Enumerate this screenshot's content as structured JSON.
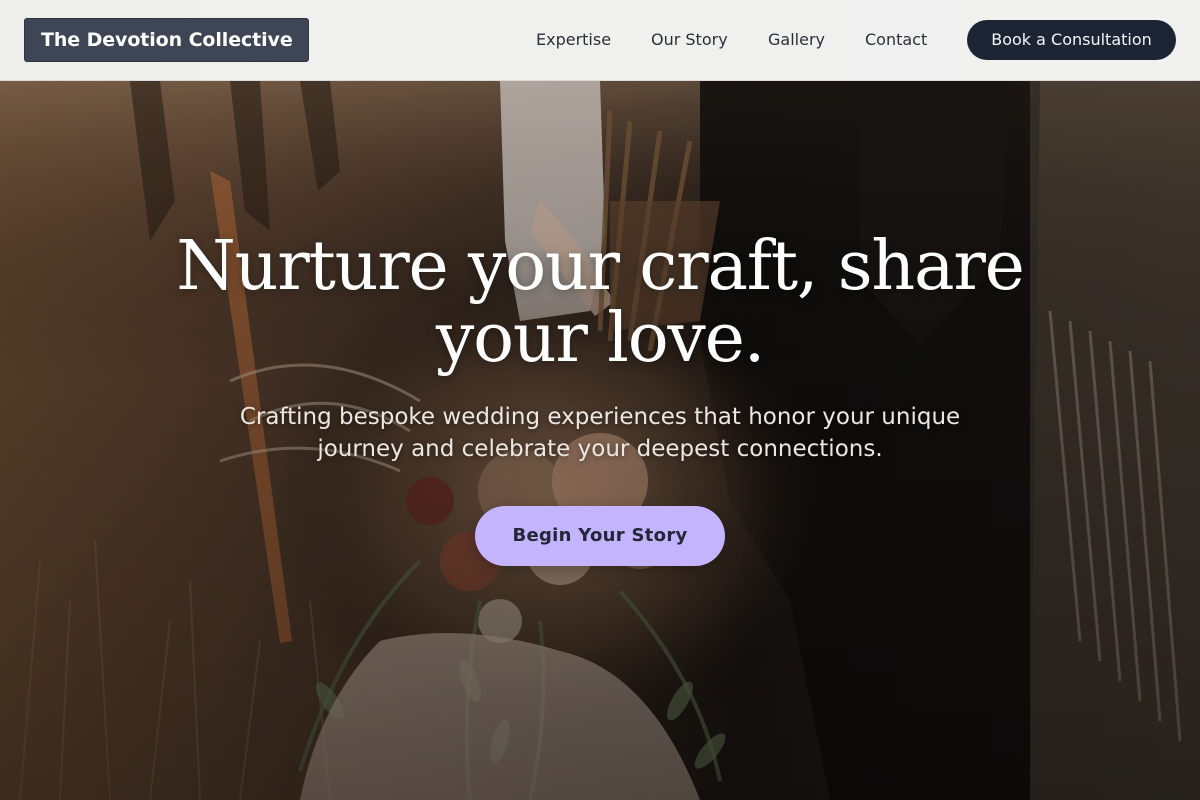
{
  "header": {
    "logo_text": "The Devotion Collective",
    "nav": {
      "expertise": "Expertise",
      "our_story": "Our Story",
      "gallery": "Gallery",
      "contact": "Contact"
    },
    "cta_label": "Book a Consultation"
  },
  "hero": {
    "title": "Nurture your craft, share your love.",
    "subtitle": "Crafting bespoke wedding experiences that honor your unique journey and celebrate your deepest connections.",
    "cta_label": "Begin Your Story",
    "background_image": "wedding-bouquet-photo"
  },
  "colors": {
    "logo_bg": "#3e4655",
    "book_button_bg": "#1d2433",
    "cta_bg": "#c4b3fd",
    "cta_text": "#232737",
    "header_bg": "#f0f0ef"
  }
}
